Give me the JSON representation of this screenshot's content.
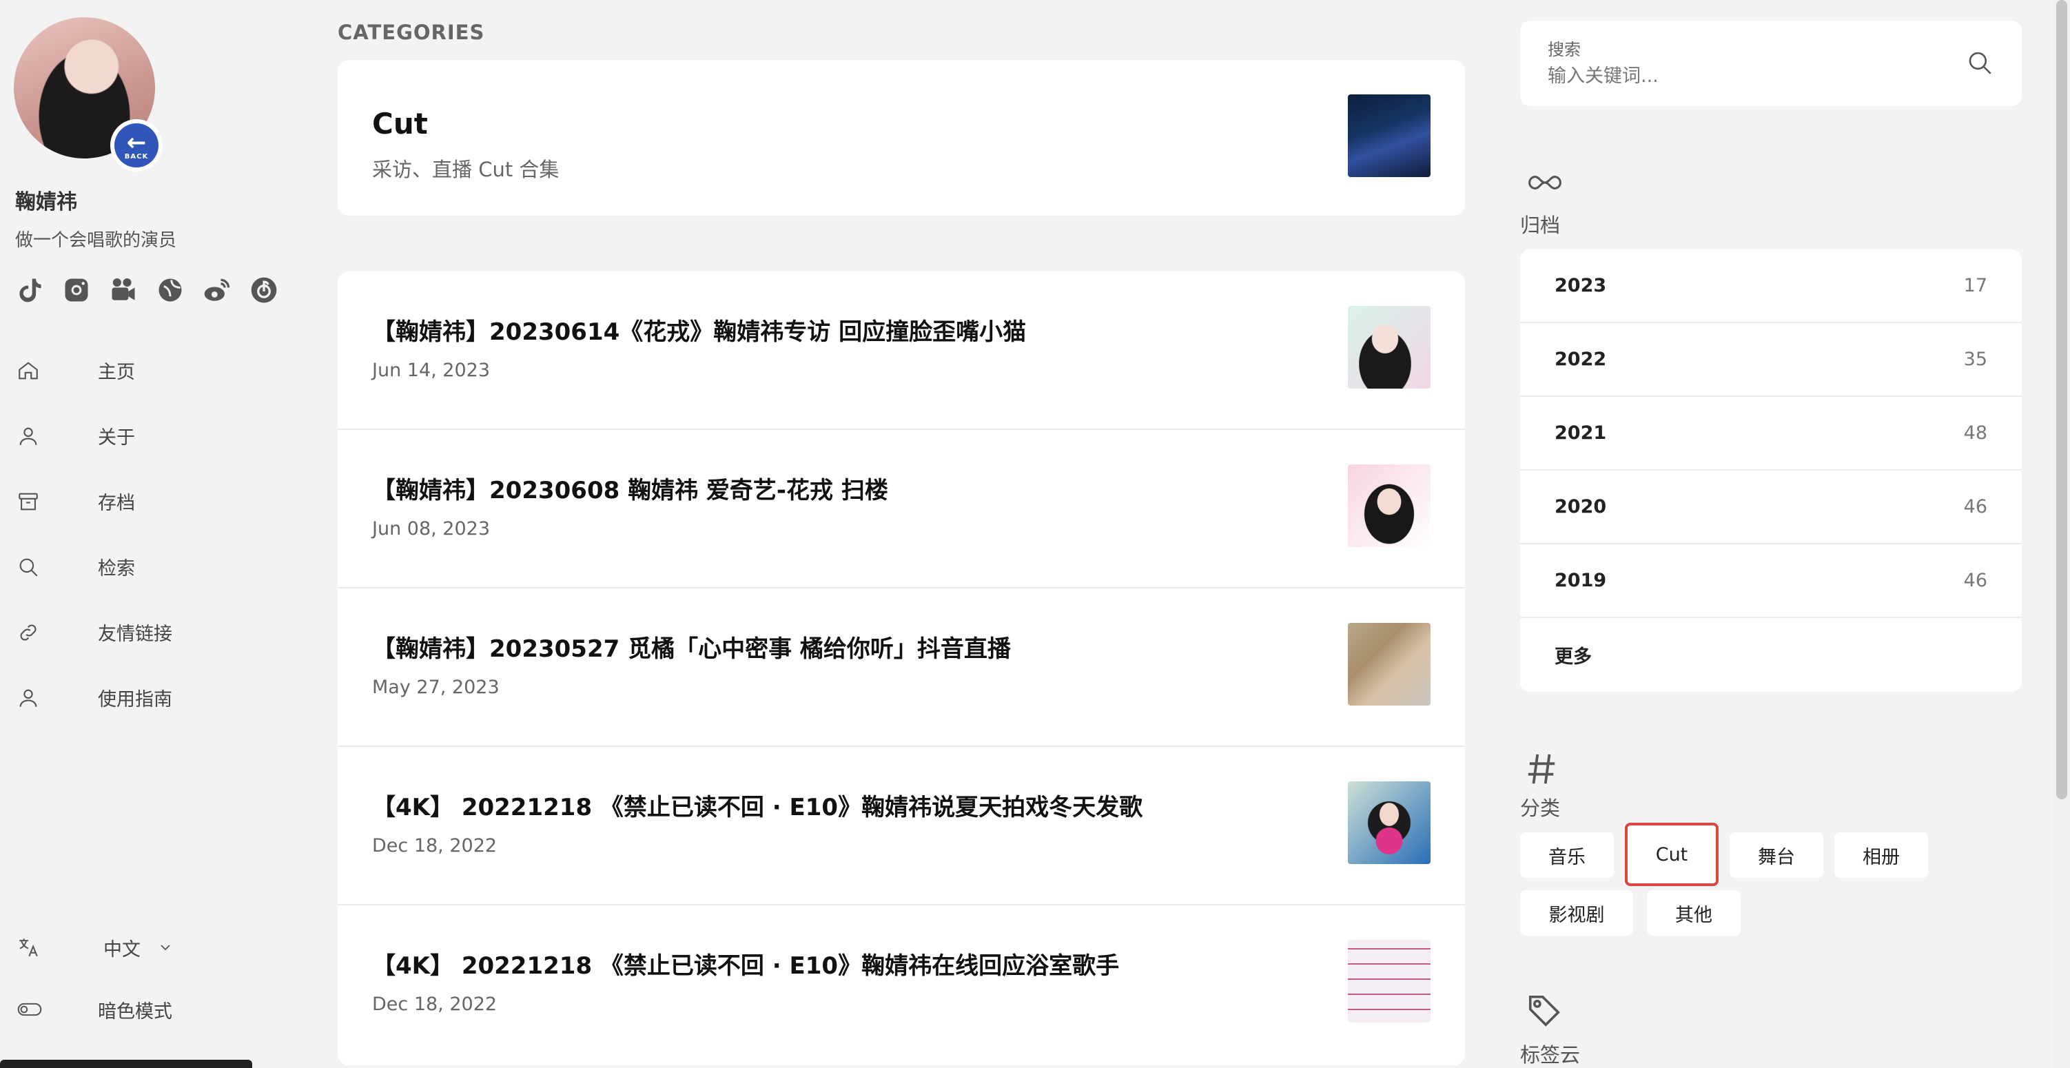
{
  "profile": {
    "name": "鞠婧祎",
    "subtitle": "做一个会唱歌的演员",
    "back_text": "BACK",
    "back_arrow": "←"
  },
  "social_icons": [
    "tiktok-icon",
    "instagram-icon",
    "video-camera-icon",
    "planet-icon",
    "weibo-icon",
    "netease-music-icon"
  ],
  "nav": [
    {
      "label": "主页",
      "icon": "home-icon"
    },
    {
      "label": "关于",
      "icon": "person-icon"
    },
    {
      "label": "存档",
      "icon": "archive-icon"
    },
    {
      "label": "检索",
      "icon": "search-icon"
    },
    {
      "label": "友情链接",
      "icon": "link-icon"
    },
    {
      "label": "使用指南",
      "icon": "person-icon"
    }
  ],
  "language": {
    "label": "中文",
    "icon": "translate-icon"
  },
  "dark_mode": {
    "label": "暗色模式",
    "icon": "toggle-icon"
  },
  "main": {
    "section_label": "CATEGORIES",
    "category": {
      "title": "Cut",
      "description": "采访、直播 Cut 合集"
    },
    "posts": [
      {
        "title": "【鞠婧祎】20230614《花戎》鞠婧祎专访 回应撞脸歪嘴小猫",
        "date": "Jun 14, 2023"
      },
      {
        "title": "【鞠婧祎】20230608 鞠婧祎 爱奇艺-花戎 扫楼",
        "date": "Jun 08, 2023"
      },
      {
        "title": "【鞠婧祎】20230527 觅橘「心中密事 橘给你听」抖音直播",
        "date": "May 27, 2023"
      },
      {
        "title": "【4K】 20221218 《禁止已读不回 · E10》鞠婧祎说夏天拍戏冬天发歌",
        "date": "Dec 18, 2022"
      },
      {
        "title": "【4K】 20221218 《禁止已读不回 · E10》鞠婧祎在线回应浴室歌手",
        "date": "Dec 18, 2022"
      }
    ]
  },
  "search": {
    "label": "搜索",
    "placeholder": "输入关键词..."
  },
  "archives": {
    "title": "归档",
    "items": [
      {
        "year": "2023",
        "count": "17"
      },
      {
        "year": "2022",
        "count": "35"
      },
      {
        "year": "2021",
        "count": "48"
      },
      {
        "year": "2020",
        "count": "46"
      },
      {
        "year": "2019",
        "count": "46"
      },
      {
        "year": "更多",
        "count": ""
      }
    ]
  },
  "categories_widget": {
    "title": "分类",
    "tags": [
      "音乐",
      "Cut",
      "舞台",
      "相册",
      "影视剧",
      "其他"
    ],
    "active": "Cut",
    "active_color": "#d9473e"
  },
  "tag_cloud": {
    "title": "标签云"
  }
}
